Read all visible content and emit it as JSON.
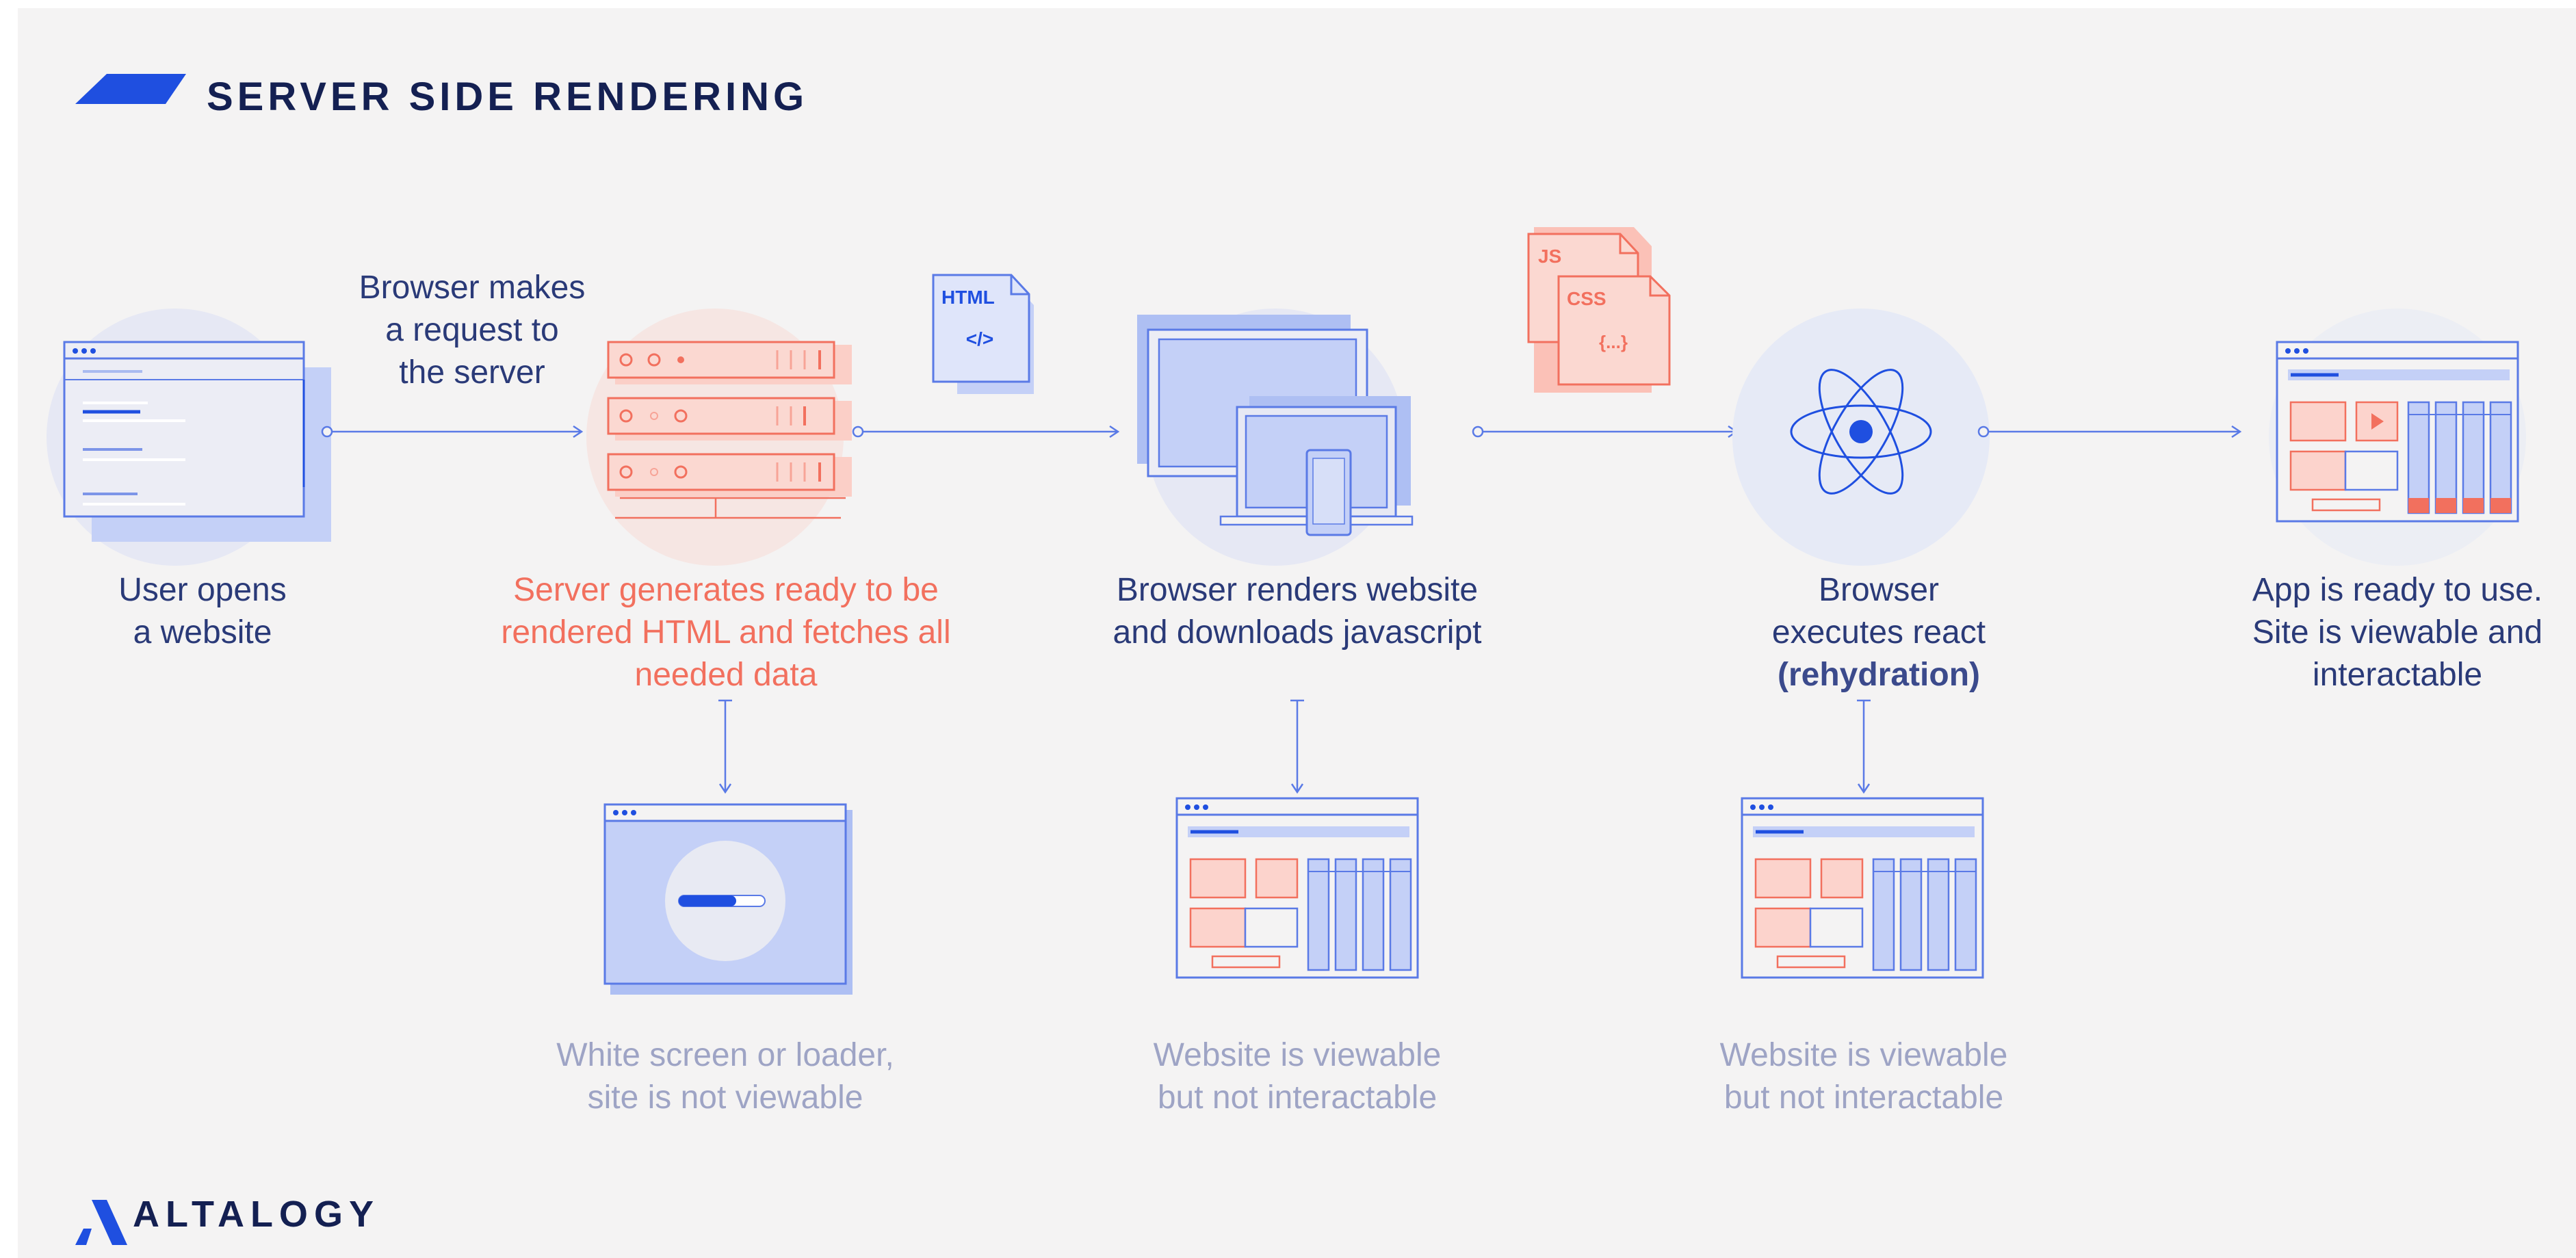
{
  "header": {
    "title": "SERVER SIDE RENDERING"
  },
  "brand": {
    "name": "ALTALOGY"
  },
  "colors": {
    "accent_blue": "#1f4fe0",
    "line_blue": "#5a7ae6",
    "fill_blue": "#c4d0f7",
    "coral": "#f2705e",
    "coral_fill": "#fcd3cc",
    "text_dark": "#2a3a78",
    "text_muted": "#9ea4c5",
    "background": "#f4f3f3"
  },
  "steps": [
    {
      "label_lines": [
        "User opens",
        "a website"
      ]
    },
    {
      "label_lines": [
        "Server generates ready to be",
        "rendered HTML and fetches all",
        "needed data"
      ]
    },
    {
      "label_lines": [
        "Browser renders website",
        "and downloads javascript"
      ]
    },
    {
      "label_lines": [
        "Browser",
        "executes react"
      ],
      "emphasis": "(rehydration)"
    },
    {
      "label_lines": [
        "App is ready to use.",
        "Site is viewable and",
        "interactable"
      ]
    }
  ],
  "connector_labels": {
    "request": [
      "Browser makes",
      "a request to",
      "the server"
    ]
  },
  "file_badges": {
    "html": {
      "title": "HTML",
      "symbol": "</>"
    },
    "js": {
      "title": "JS"
    },
    "css": {
      "title": "CSS",
      "symbol": "{...}"
    }
  },
  "substates": [
    {
      "label_lines": [
        "White screen or loader,",
        "site is not viewable"
      ]
    },
    {
      "label_lines": [
        "Website is viewable",
        "but not interactable"
      ]
    },
    {
      "label_lines": [
        "Website is viewable",
        "but not interactable"
      ]
    }
  ],
  "icons": {
    "step1": "browser-window-icon",
    "step2": "server-rack-icon",
    "step3": "multi-device-icon",
    "step4": "react-atom-icon",
    "step5": "interactive-app-icon",
    "sub1": "loader-window-icon",
    "sub2": "static-page-icon",
    "sub3": "static-page-icon",
    "logo": "altalogy-logo-icon"
  }
}
